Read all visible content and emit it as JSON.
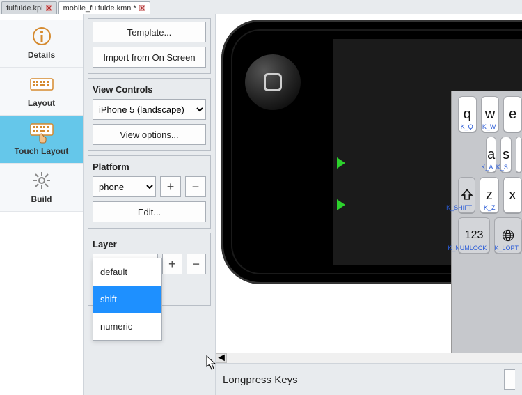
{
  "tabs": {
    "items": [
      {
        "label": "fulfulde.kpi"
      },
      {
        "label": "mobile_fulfulde.kmn *"
      }
    ],
    "active_index": 1
  },
  "side_tabs": {
    "items": [
      {
        "id": "details",
        "label": "Details"
      },
      {
        "id": "layout",
        "label": "Layout"
      },
      {
        "id": "touch-layout",
        "label": "Touch Layout"
      },
      {
        "id": "build",
        "label": "Build"
      }
    ],
    "active_id": "touch-layout"
  },
  "options": {
    "template_btn": "Template...",
    "import_btn": "Import from On Screen",
    "view_controls_title": "View Controls",
    "device_select": "iPhone 5 (landscape)",
    "view_options_btn": "View options...",
    "platform_title": "Platform",
    "platform_select": "phone",
    "plus": "+",
    "minus": "−",
    "edit_btn": "Edit...",
    "layer_title": "Layer",
    "layer_select": "default",
    "layer_options": [
      "default",
      "shift",
      "numeric"
    ],
    "layer_hover_index": 1
  },
  "preview": {
    "keys_row1": [
      {
        "cap": "q",
        "code": "K_Q"
      },
      {
        "cap": "w",
        "code": "K_W"
      },
      {
        "cap": "e",
        "code": ""
      }
    ],
    "keys_row2": [
      {
        "cap": "a",
        "code": "K_A"
      },
      {
        "cap": "s",
        "code": "K_S"
      },
      {
        "cap": "",
        "code": ""
      }
    ],
    "keys_row3": [
      {
        "cap": "shift-icon",
        "code": "K_SHIFT",
        "grey": true
      },
      {
        "cap": "z",
        "code": "K_Z"
      },
      {
        "cap": "x",
        "code": ""
      }
    ],
    "keys_row4": [
      {
        "cap": "123",
        "code": "K_NUMLOCK",
        "grey": true
      },
      {
        "cap": "globe-icon",
        "code": "K_LOPT",
        "grey": true
      }
    ]
  },
  "bottom": {
    "longpress_label": "Longpress Keys"
  }
}
